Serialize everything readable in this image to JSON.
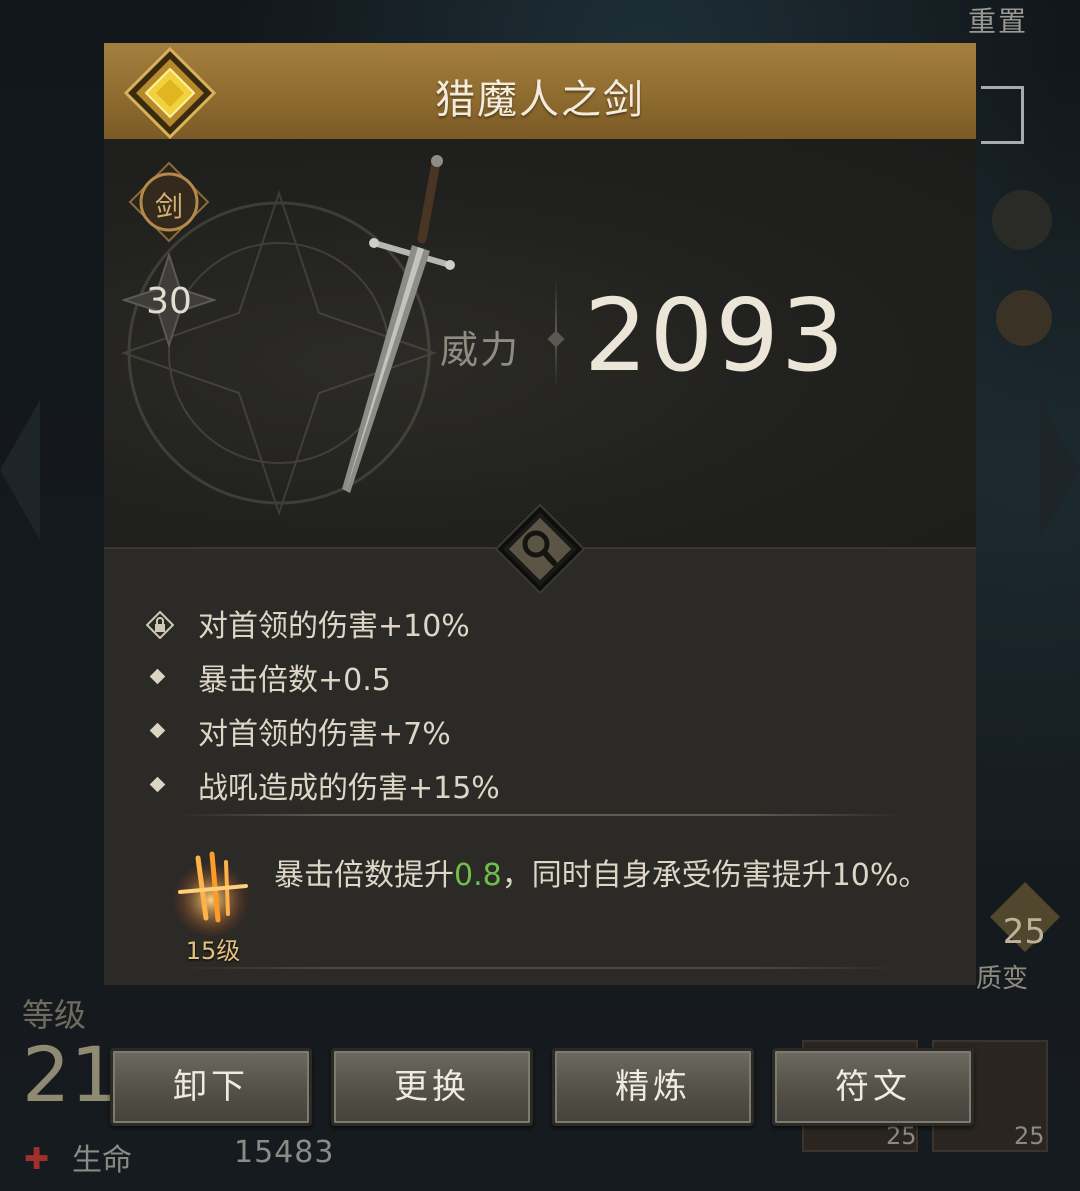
{
  "background": {
    "reset_label": "重置",
    "level_label": "等级",
    "level_value": "21",
    "hp_label": "生命",
    "hp_value": "15483",
    "right_badge_value": "25",
    "right_badge_label": "质变",
    "cell_counts": [
      "25",
      "25"
    ]
  },
  "item": {
    "name": "猎魔人之剑",
    "type_label": "剑",
    "level": "30",
    "power_label": "威力",
    "power_value": "2093",
    "stats": [
      {
        "locked": true,
        "text": "对首领的伤害+10%"
      },
      {
        "locked": false,
        "text": "暴击倍数+0.5"
      },
      {
        "locked": false,
        "text": "对首领的伤害+7%"
      },
      {
        "locked": false,
        "text": "战吼造成的伤害+15%"
      }
    ],
    "skill": {
      "level_label": "15级",
      "text_before": "暴击倍数提升",
      "text_highlight": "0.8",
      "text_after": "，同时自身承受伤害提升10%。",
      "highlight_color": "#6fbf4a"
    }
  },
  "buttons": {
    "unequip": "卸下",
    "replace": "更换",
    "refine": "精炼",
    "rune": "符文"
  },
  "colors": {
    "header": "#a47f3f",
    "rarity": "#e8c534"
  }
}
